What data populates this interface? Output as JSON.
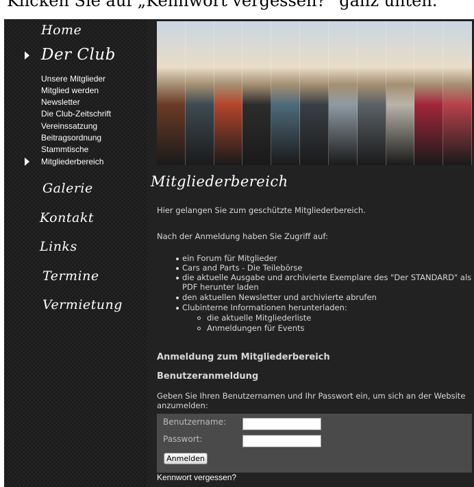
{
  "top_banner": {
    "text": "Klicken Sie auf „Kennwort vergessen?“ ganz unten."
  },
  "nav": {
    "home": "Home",
    "club": "Der Club",
    "club_sub": [
      "Unsere Mitglieder",
      "Mitglied werden",
      "Newsletter",
      "Die Club-Zeitschrift",
      "Vereinssatzung",
      "Beitragsordnung",
      "Stammtische",
      "Mitgliederbereich"
    ],
    "galerie": "Galerie",
    "kontakt": "Kontakt",
    "links": "Links",
    "termine": "Termine",
    "vermietung": "Vermietung"
  },
  "banner": {
    "strip_colors": [
      "#6b3a26",
      "#3d4a52",
      "#b3452b",
      "#2c2c2c",
      "#4e6a7a",
      "#3a3f44",
      "#8e9aa3",
      "#5b6166",
      "#b9b3a8",
      "#a3263a",
      "#b5414b"
    ]
  },
  "page_title": "Mitgliederbereich",
  "intro": "Hier gelangen Sie zum geschützte Mitgliederbereich.",
  "access_intro": "Nach der Anmeldung haben Sie Zugriff auf:",
  "features": [
    "ein Forum für Mitglieder",
    "Cars and Parts - Die Teilebörse",
    "die aktuelle Ausgabe und archivierte Exemplare des \"Der STANDARD\" als",
    "PDF herunter laden",
    "den aktuellen Newsletter und archivierte abrufen",
    "Clubinterne Informationen herunterladen:"
  ],
  "subfeatures": [
    "die aktuelle Mitgliederliste",
    "Anmeldungen für Events"
  ],
  "login": {
    "heading": "Anmeldung zum Mitgliederbereich",
    "subheading": "Benutzeranmeldung",
    "instructions_line1": "Geben Sie Ihren Benutzernamen und Ihr Passwort ein, um sich an der Website",
    "instructions_line2": "anzumelden:",
    "username_label": "Benutzername:",
    "password_label": "Passwort:",
    "username_value": "",
    "password_value": "",
    "submit_label": "Anmelden",
    "forgot_label": "Kennwort vergessen?"
  }
}
